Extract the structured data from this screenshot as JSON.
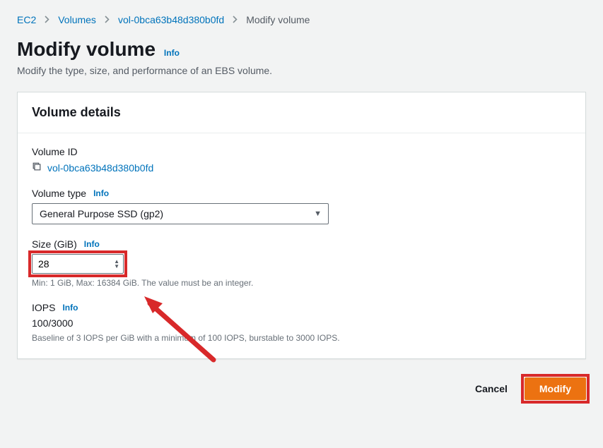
{
  "breadcrumb": {
    "ec2": "EC2",
    "volumes": "Volumes",
    "volume_id": "vol-0bca63b48d380b0fd",
    "current": "Modify volume"
  },
  "header": {
    "title": "Modify volume",
    "info": "Info",
    "subtitle": "Modify the type, size, and performance of an EBS volume."
  },
  "panel": {
    "title": "Volume details",
    "volume_id_label": "Volume ID",
    "volume_id_value": "vol-0bca63b48d380b0fd",
    "volume_type": {
      "label": "Volume type",
      "info": "Info",
      "selected": "General Purpose SSD (gp2)"
    },
    "size": {
      "label": "Size (GiB)",
      "info": "Info",
      "value": "28",
      "hint": "Min: 1 GiB, Max: 16384 GiB. The value must be an integer."
    },
    "iops": {
      "label": "IOPS",
      "info": "Info",
      "value": "100/3000",
      "hint": "Baseline of 3 IOPS per GiB with a minimum of 100 IOPS, burstable to 3000 IOPS."
    }
  },
  "actions": {
    "cancel": "Cancel",
    "modify": "Modify"
  }
}
